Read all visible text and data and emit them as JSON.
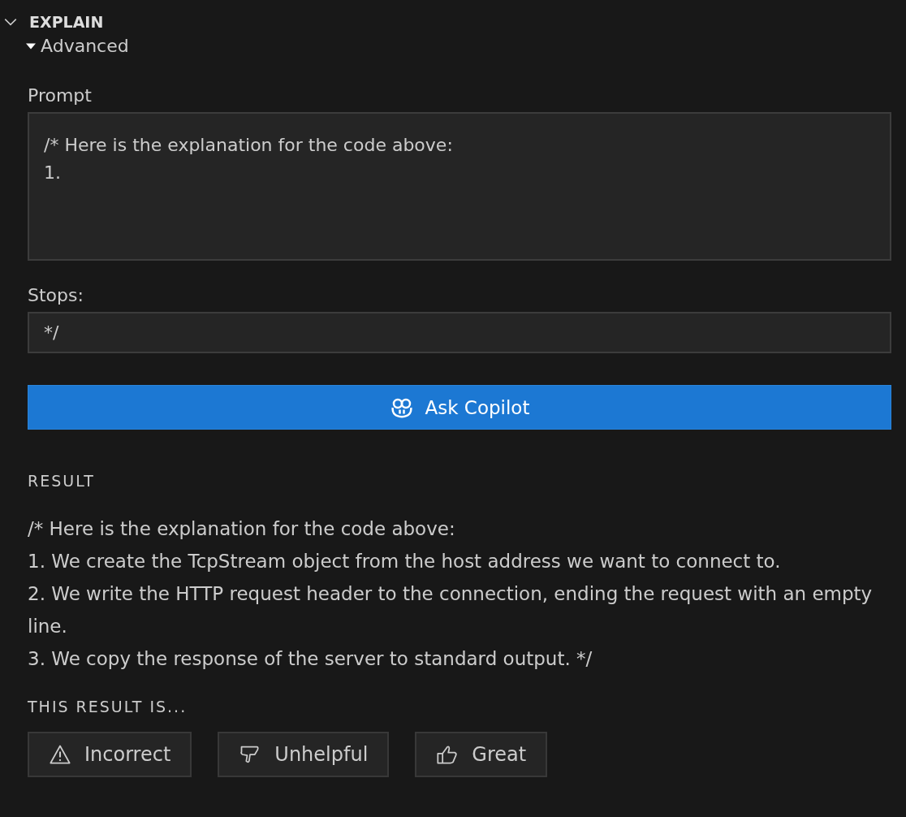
{
  "section": {
    "title": "EXPLAIN",
    "expanded": true
  },
  "advanced": {
    "label": "Advanced",
    "expanded": true
  },
  "prompt": {
    "label": "Prompt",
    "value": "/* Here is the explanation for the code above:\n1."
  },
  "stops": {
    "label": "Stops:",
    "value": "*/"
  },
  "ask_button": {
    "label": "Ask Copilot"
  },
  "result": {
    "heading": "RESULT",
    "lines": [
      "/* Here is the explanation for the code above:",
      "1. We create the TcpStream object from the host address we want to connect to.",
      "2. We write the HTTP request header to the connection, ending the request with an empty line.",
      "3. We copy the response of the server to standard output. */"
    ]
  },
  "feedback": {
    "heading": "THIS RESULT IS...",
    "buttons": [
      {
        "kind": "warning",
        "label": "Incorrect"
      },
      {
        "kind": "thumbs-down",
        "label": "Unhelpful"
      },
      {
        "kind": "thumbs-up",
        "label": "Great"
      }
    ]
  }
}
